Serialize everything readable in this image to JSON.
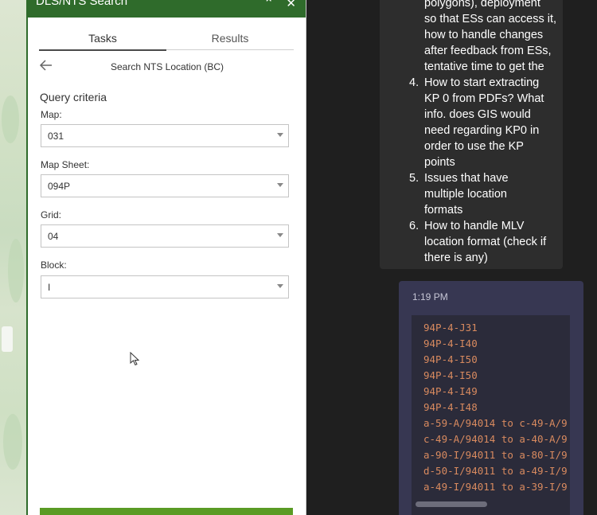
{
  "panel": {
    "title": "DLS/NTS Search",
    "tabs": [
      "Tasks",
      "Results"
    ],
    "subtitle": "Search NTS Location (BC)",
    "section_title": "Query criteria",
    "fields": [
      {
        "label": "Map:",
        "value": "031"
      },
      {
        "label": "Map Sheet:",
        "value": "094P"
      },
      {
        "label": "Grid:",
        "value": "04"
      },
      {
        "label": "Block:",
        "value": "I"
      }
    ]
  },
  "chat": {
    "message1": {
      "lines": [
        "polygons), deployment",
        "so that ESs can access it,",
        "how to handle changes",
        "after feedback from ESs,",
        "tentative time to get the"
      ],
      "items": [
        {
          "num": "4.",
          "lines": [
            "How to start extracting",
            "KP 0 from PDFs? What",
            "info. does GIS would",
            "need regarding KP0 in",
            "order to use the KP",
            "points"
          ]
        },
        {
          "num": "5.",
          "lines": [
            "Issues that have",
            "multiple location",
            "formats"
          ]
        },
        {
          "num": "6.",
          "lines": [
            "How to handle MLV",
            "location format (check if",
            "there is any)"
          ]
        }
      ]
    },
    "message2": {
      "time": "1:19 PM",
      "code_lines": [
        "94P-4-J31",
        "94P-4-I40",
        "94P-4-I50",
        "94P-4-I50",
        "94P-4-I49",
        "94P-4-I48",
        "a-59-A/94014 to c-49-A/9",
        "c-49-A/94014 to a-40-A/9",
        "a-90-I/94011 to a-80-I/9",
        "d-50-I/94011 to a-49-I/9",
        "a-49-I/94011 to a-39-I/9"
      ]
    }
  }
}
